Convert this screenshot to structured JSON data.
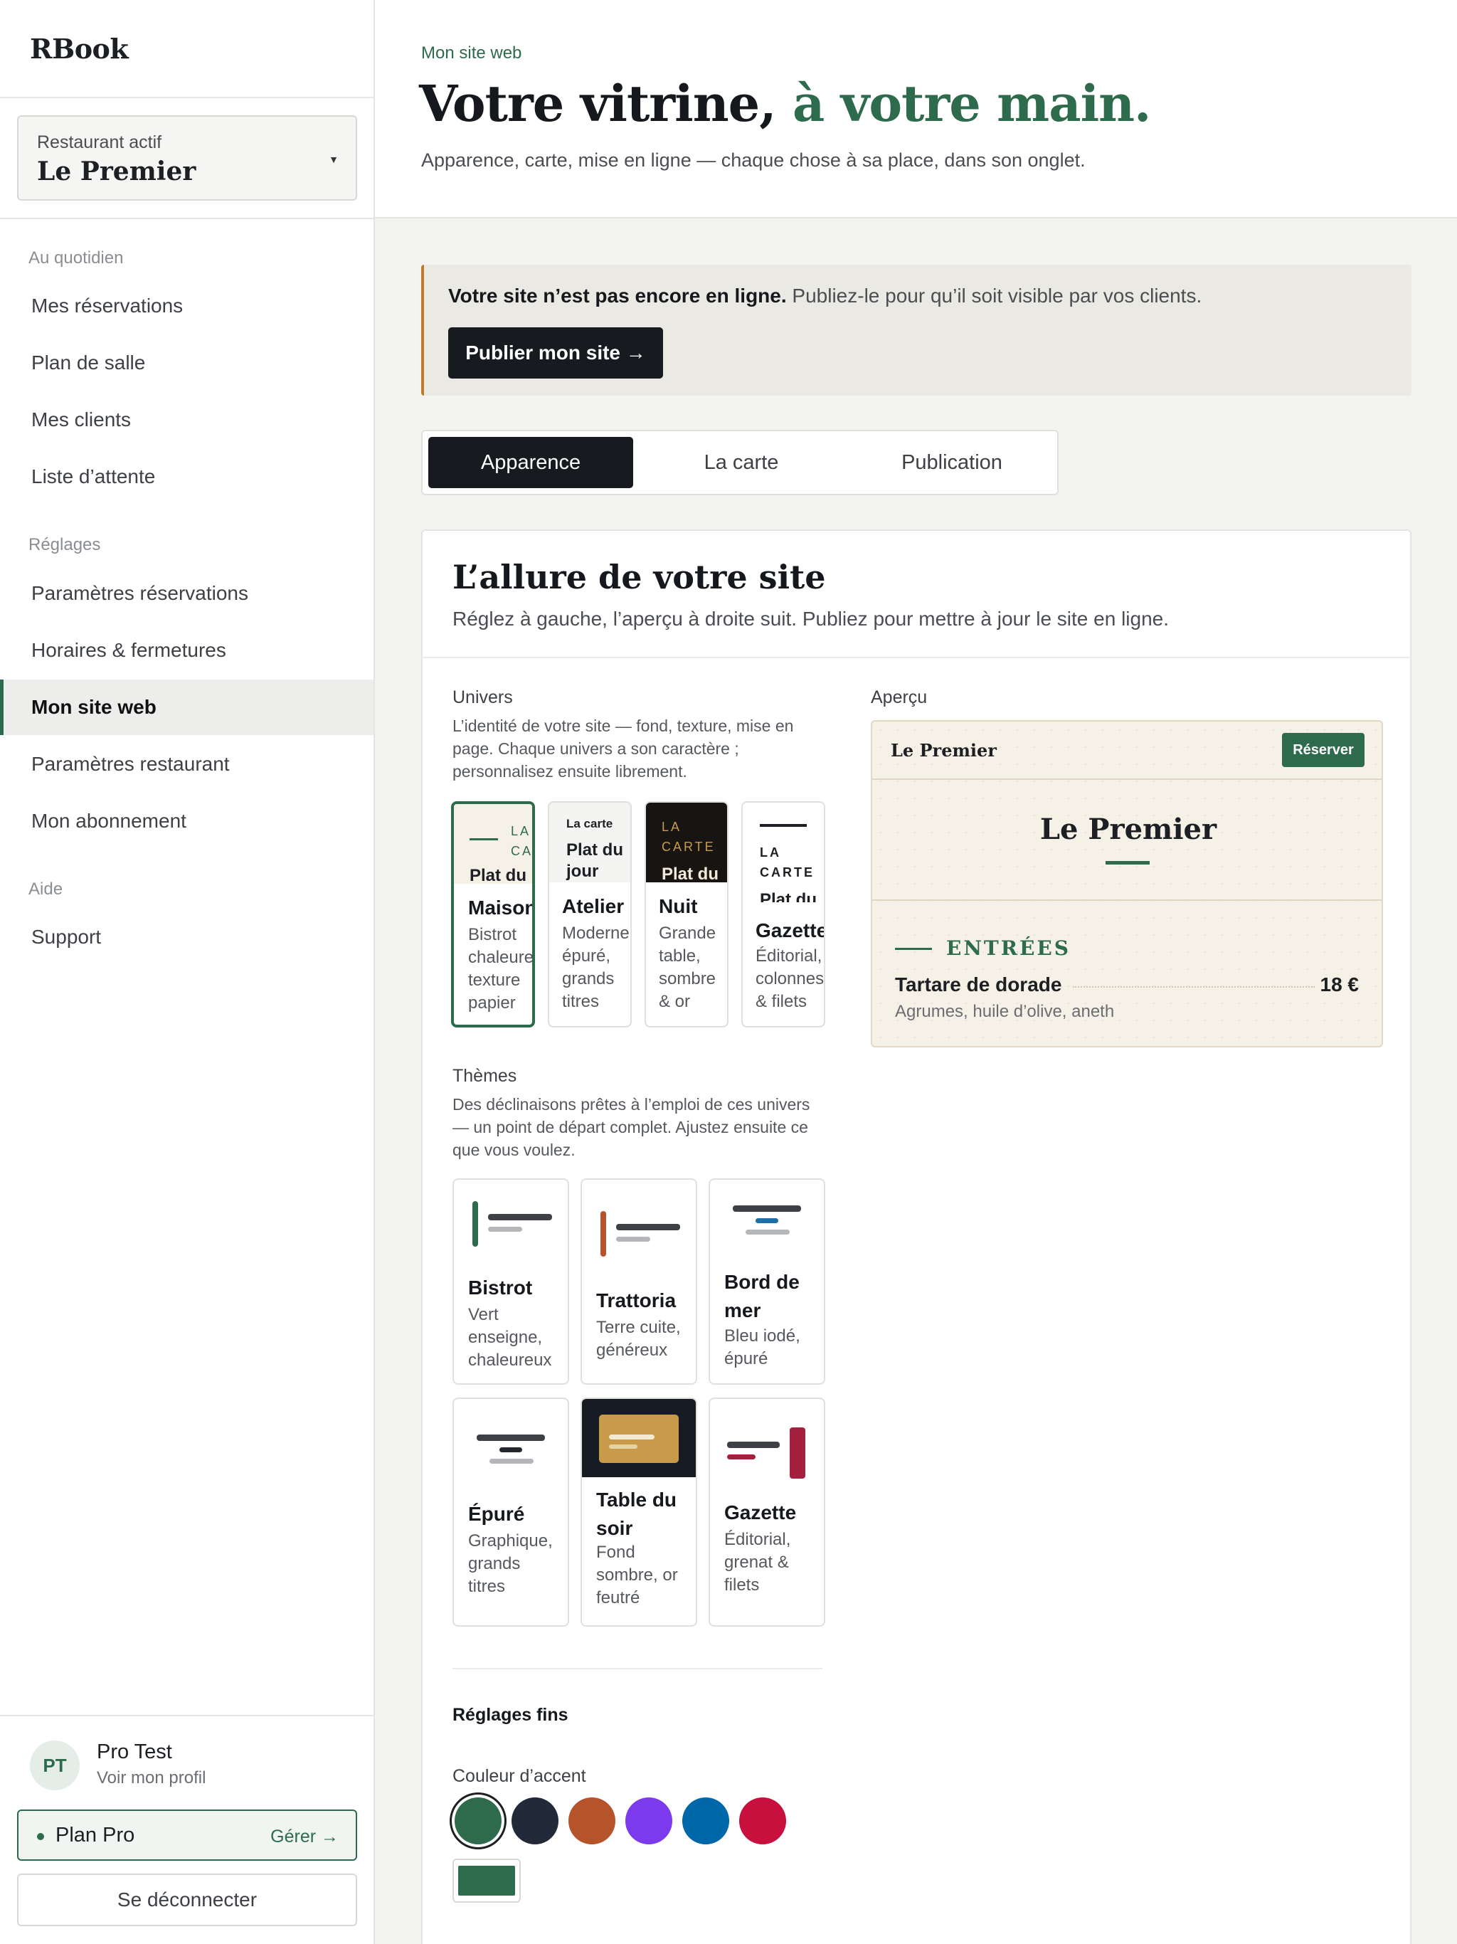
{
  "sidebar": {
    "logo": "RBook",
    "restaurant_label": "Restaurant actif",
    "restaurant_name": "Le Premier",
    "sections": [
      {
        "title": "Au quotidien",
        "items": [
          "Mes réservations",
          "Plan de salle",
          "Mes clients",
          "Liste d’attente"
        ]
      },
      {
        "title": "Réglages",
        "items": [
          "Paramètres réservations",
          "Horaires & fermetures",
          "Mon site web",
          "Paramètres restaurant",
          "Mon abonnement"
        ]
      },
      {
        "title": "Aide",
        "items": [
          "Support"
        ]
      }
    ],
    "active_item": "Mon site web",
    "profile": {
      "initials": "PT",
      "name": "Pro Test",
      "link": "Voir mon profil"
    },
    "plan": {
      "name": "Plan Pro",
      "manage": "Gérer →"
    },
    "logout": "Se déconnecter"
  },
  "header": {
    "eyebrow": "Mon site web",
    "title_main": "Votre vitrine, ",
    "title_accent": "à votre main.",
    "subtitle": "Apparence, carte, mise en ligne — chaque chose à sa place, dans son onglet."
  },
  "banner": {
    "bold": "Votre site n’est pas encore en ligne.",
    "text": " Publiez-le pour qu’il soit visible par vos clients.",
    "button": "Publier mon site →"
  },
  "tabs": [
    "Apparence",
    "La carte",
    "Publication"
  ],
  "card": {
    "title": "L’allure de votre site",
    "subtitle": "Réglez à gauche, l’aperçu à droite suit. Publiez pour mettre à jour le site en ligne.",
    "univers": {
      "label": "Univers",
      "desc": "L’identité de votre site — fond, texture, mise en page. Chaque univers a son caractère ; personnalisez ensuite librement.",
      "tiles": [
        {
          "preview_small": "LA CA",
          "preview_text": "Plat du jour",
          "name": "Maison",
          "desc": "Bistrot chaleureux texture papier",
          "selected": true
        },
        {
          "preview_small": "La carte",
          "preview_text": "Plat du jour",
          "name": "Atelier",
          "desc": "Moderne épuré, grands titres",
          "selected": false
        },
        {
          "preview_small": "LA CARTE",
          "preview_text": "Plat du",
          "name": "Nuit",
          "desc": "Grande table, sombre & or",
          "selected": false
        },
        {
          "preview_small": "LA CARTE",
          "preview_text": "Plat du jour",
          "name": "Gazette",
          "desc": "Éditorial, colonnes & filets",
          "selected": false
        }
      ]
    },
    "themes": {
      "label": "Thèmes",
      "desc": "Des déclinaisons prêtes à l’emploi de ces univers — un point de départ complet. Ajustez ensuite ce que vous voulez.",
      "tiles": [
        {
          "name": "Bistrot",
          "desc": "Vert enseigne, chaleureux",
          "color": "#2e6b4c"
        },
        {
          "name": "Trattoria",
          "desc": "Terre cuite, généreux",
          "color": "#b5532a"
        },
        {
          "name": "Bord de mer",
          "desc": "Bleu iodé, épuré",
          "color": "#1d6fa5"
        },
        {
          "name": "Épuré",
          "desc": "Graphique, grands titres",
          "color": "#23272e"
        },
        {
          "name": "Table du soir",
          "desc": "Fond sombre, or feutré",
          "color": "#c89a4a"
        },
        {
          "name": "Gazette",
          "desc": "Éditorial, grenat & filets",
          "color": "#a3203f"
        }
      ]
    },
    "fine_settings": {
      "label": "Réglages fins",
      "accent_label": "Couleur d’accent",
      "accent_colors": [
        "#2e6b4c",
        "#222a3a",
        "#b5532a",
        "#7c3aed",
        "#0068a8",
        "#c8103e"
      ],
      "selected_accent": "#2e6b4c"
    },
    "preview": {
      "label": "Aperçu",
      "site_name": "Le Premier",
      "book_button": "Réserver",
      "title": "Le Premier",
      "section": "ENTRÉES",
      "dish": "Tartare de dorade",
      "dish_desc": "Agrumes, huile d’olive, aneth",
      "price": "18 €"
    }
  }
}
